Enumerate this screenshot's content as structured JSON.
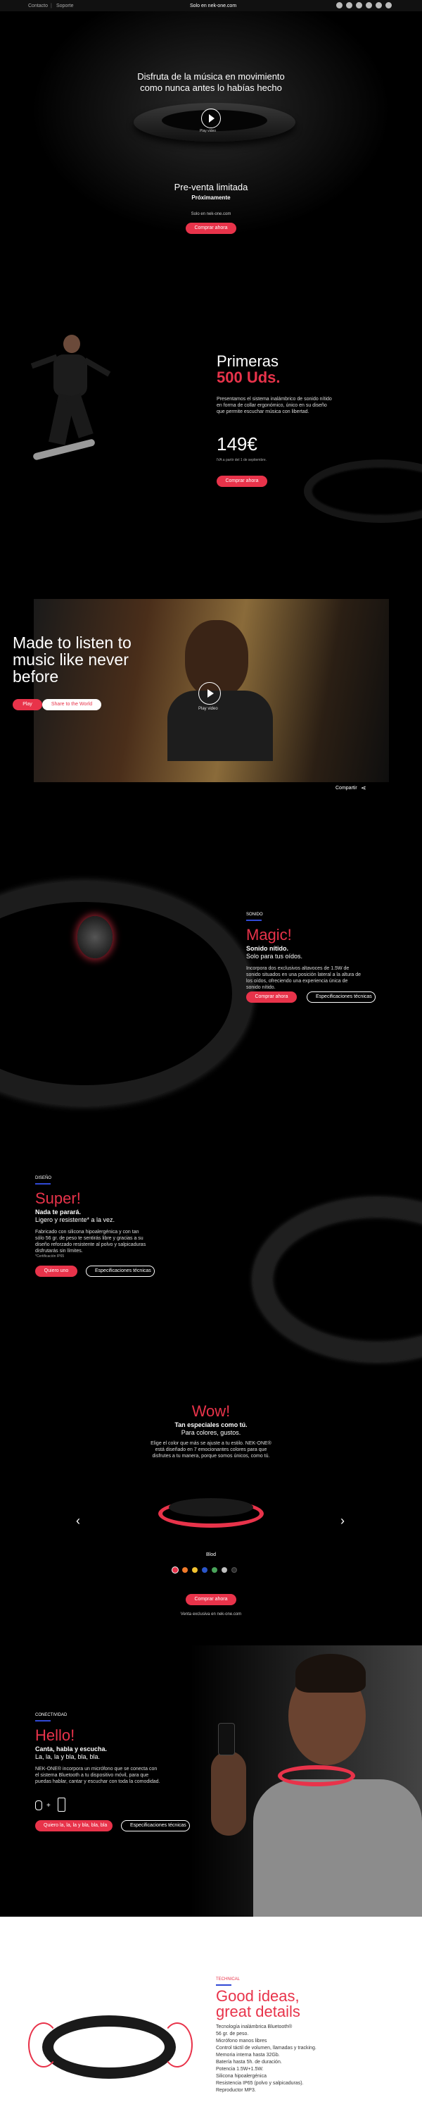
{
  "topbar": {
    "links": [
      "Contacto",
      "Soporte"
    ],
    "separator": "|",
    "center": "Solo en nek-one.com",
    "social": [
      "facebook-icon",
      "twitter-icon",
      "instagram-icon",
      "youtube-icon",
      "pinterest-icon",
      "linkedin-icon"
    ]
  },
  "hero": {
    "headline": "Disfruta de la música en movimiento como nunca antes lo habías hecho",
    "play_label": "Play video",
    "presale": "Pre-venta limitada",
    "soon": "Próximamente",
    "only": "Solo en nek-one.com",
    "cta": "Comprar ahora"
  },
  "first": {
    "title1": "Primeras",
    "title2": "500 Uds.",
    "desc": "Presentamos el sistema inalámbrico de sonido nítido en forma de collar ergonómico, único en su diseño que permite escuchar música con libertad.",
    "price": "149€",
    "note": "IVA a partir del 1 de septiembre.",
    "cta": "Comprar ahora"
  },
  "video": {
    "headline": "Made to listen to music like never before",
    "play": "Play",
    "share_btn": "Share to the World",
    "play_label": "Play video",
    "share": "Compartir"
  },
  "sound": {
    "tag": "SONIDO",
    "title": "Magic!",
    "sub1": "Sonido nítido.",
    "sub2": "Solo para tus oídos.",
    "desc": "Incorpora dos exclusivos altavoces de 1.5W de sonido situados en una posición lateral a la altura de los oídos, ofreciendo una experiencia única de sonido nítido.",
    "cta": "Comprar ahora",
    "specs": "Especificaciones técnicas"
  },
  "design": {
    "tag": "DISEÑO",
    "title": "Super!",
    "sub1": "Nada te parará.",
    "sub2": "Ligero y resistente* a la vez.",
    "desc": "Fabricado con silicona hipoalergénica y con tan sólo 56 gr. de peso te sentirás libre y gracias a su diseño reforzado resistente al polvo y salpicaduras disfrutarás sin límites.",
    "note": "*Certificación IP65",
    "cta": "Quiero uno",
    "specs": "Especificaciones técnicas"
  },
  "colors": {
    "title": "Wow!",
    "sub1": "Tan especiales como tú.",
    "sub2": "Para colores, gustos.",
    "desc": "Elige el color que más se ajuste a tu estilo. NEK-ONE® está diseñado en 7 emocionantes colores para que disfrutes a tu manera, porque somos únicos, como tú.",
    "selected": "Blod",
    "swatches": [
      "#e8334a",
      "#f07a2a",
      "#f2c230",
      "#2a55c9",
      "#49a35a",
      "#bfbfbf",
      "#2b2b2b"
    ],
    "prev": "‹",
    "next": "›",
    "cta": "Comprar ahora",
    "note": "Venta exclusiva en nek-one.com"
  },
  "connect": {
    "tag": "CONECTIVIDAD",
    "title": "Hello!",
    "sub1": "Canta, habla y escucha.",
    "sub2": "La, la, la y bla, bla, bla.",
    "desc": "NEK-ONE® incorpora un micrófono que se conecta con el sistema Bluetooth a tu dispositivo móvil, para que puedas hablar, cantar y escuchar con toda la comodidad.",
    "plus": "+",
    "cta": "Quiero la, la, la y bla, bla, bla",
    "specs": "Especificaciones técnicas"
  },
  "technical": {
    "tag": "TECHNICAL",
    "title1": "Good ideas,",
    "title2": "great details",
    "items": [
      "Tecnología inalámbrica Bluetooth®",
      "56 gr. de peso.",
      "Micrófono manos libres",
      "Control táctil de volumen, llamadas y tracking.",
      "Memoria interna hasta 32Gb.",
      "Batería hasta 5h. de duración.",
      "Potencia 1.5W+1.5W.",
      "Silicona hipoalergénica",
      "Resistencia IP65 (polvo y salpicaduras).",
      "Reproductor MP3."
    ]
  }
}
